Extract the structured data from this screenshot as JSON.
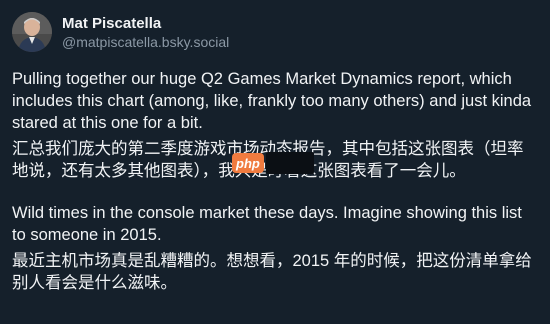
{
  "author": {
    "display_name": "Mat Piscatella",
    "handle": "@matpiscatella.bsky.social",
    "avatar_icon": "person-avatar-icon"
  },
  "post": {
    "paragraph_1_en": "Pulling together our huge Q2 Games Market Dynamics report, which includes this chart (among, like, frankly too many others) and just kinda stared at this one for a bit.",
    "paragraph_1_cn": "汇总我们庞大的第二季度游戏市场动态报告，其中包括这张图表（坦率地说，还有太多其他图表），我只是盯着这张图表看了一会儿。",
    "paragraph_2_en": "Wild times in the console market these days. Imagine showing this list to someone in 2015.",
    "paragraph_2_cn": "最近主机市场真是乱糟糟的。想想看，2015 年的时候，把这份清单拿给别人看会是什么滋味。"
  },
  "watermark": {
    "logo_text": "php"
  },
  "colors": {
    "background": "#15202b",
    "text": "#f1f3f5",
    "muted": "#8b98a5",
    "watermark_orange": "#f07b3f"
  }
}
